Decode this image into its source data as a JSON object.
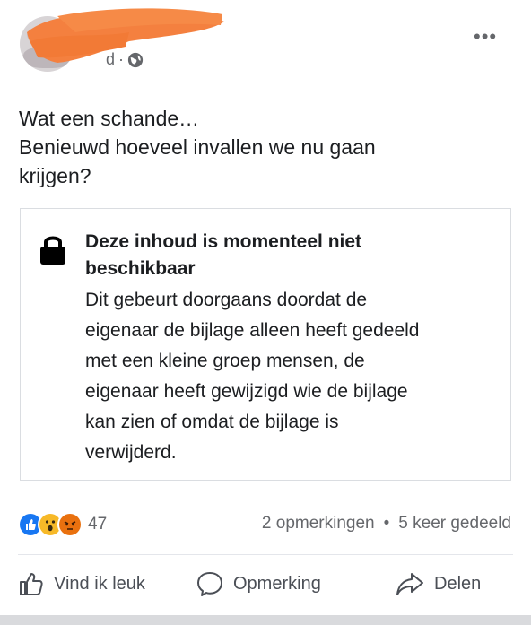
{
  "post": {
    "time": "d",
    "separator": "·",
    "more_label": "•••",
    "text_lines": [
      "Wat een schande…",
      "Benieuwd hoeveel invallen we nu gaan",
      "krijgen?"
    ]
  },
  "attachment": {
    "title_lines": [
      "Deze inhoud is momenteel niet",
      "beschikbaar"
    ],
    "body_lines": [
      "Dit gebeurt doorgaans doordat de",
      "eigenaar de bijlage alleen heeft gedeeld",
      "met een kleine groep mensen, de",
      "eigenaar heeft gewijzigd wie de bijlage",
      "kan zien of omdat de bijlage is",
      "verwijderd."
    ]
  },
  "engagement": {
    "reaction_count": "47",
    "comments": "2 opmerkingen",
    "dot": "•",
    "shares": "5 keer gedeeld",
    "reactions": [
      "like-icon",
      "wow-icon",
      "angry-icon"
    ]
  },
  "actions": {
    "like": "Vind ik leuk",
    "comment": "Opmerking",
    "share": "Delen"
  },
  "colors": {
    "like": "#1877f2",
    "wow": "#f7b928",
    "angry": "#e9710f",
    "redaction": "#f4803f"
  }
}
